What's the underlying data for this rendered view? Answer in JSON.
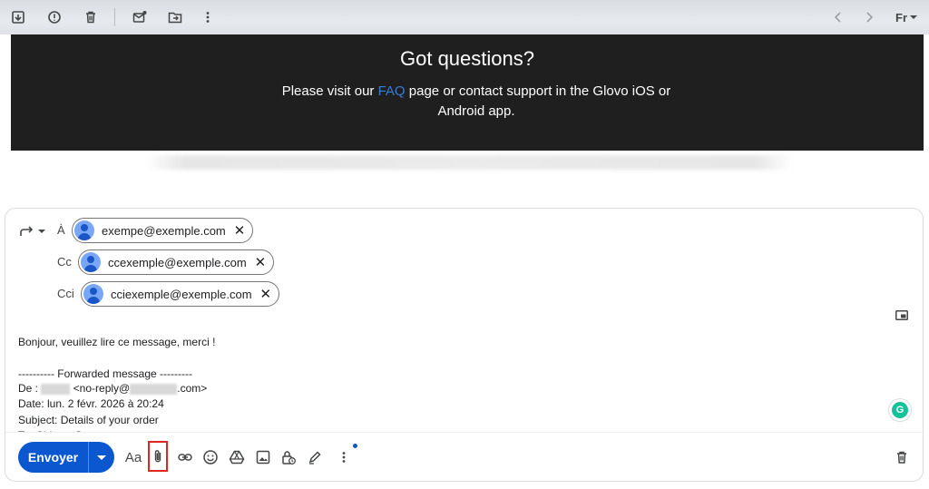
{
  "banner": {
    "title": "Got questions?",
    "line1_pre": "Please visit our ",
    "line1_link": "FAQ",
    "line1_post": " page or contact support in the Glovo iOS or",
    "line2": "Android app."
  },
  "recipients": {
    "to_label": "À",
    "cc_label": "Cc",
    "bcc_label": "Cci",
    "to": "exempe@exemple.com",
    "cc": "ccexemple@exemple.com",
    "bcc": "cciexemple@exemple.com",
    "remove_glyph": "✕"
  },
  "message": {
    "greeting": "Bonjour, veuillez lire ce message, merci !",
    "forwarded_header": "---------- Forwarded message ---------",
    "from_prefix": "De : ",
    "from_email_pre": " <no-reply@",
    "from_email_post": ".com>",
    "date_line": "Date: lun. 2 févr. 2026 à 20:24",
    "subject_line": "Subject: Details of your order",
    "to_line_partial": "To: Chivato@..."
  },
  "toolbar": {
    "send_label": "Envoyer",
    "format_label": "Aa",
    "grammarly_label": "G",
    "account_label": "Fr"
  },
  "colors": {
    "send_blue": "#0b57d0",
    "banner_bg": "#1f1f1f",
    "highlight_red": "#e0271f",
    "link_blue": "#3a7bd5"
  }
}
